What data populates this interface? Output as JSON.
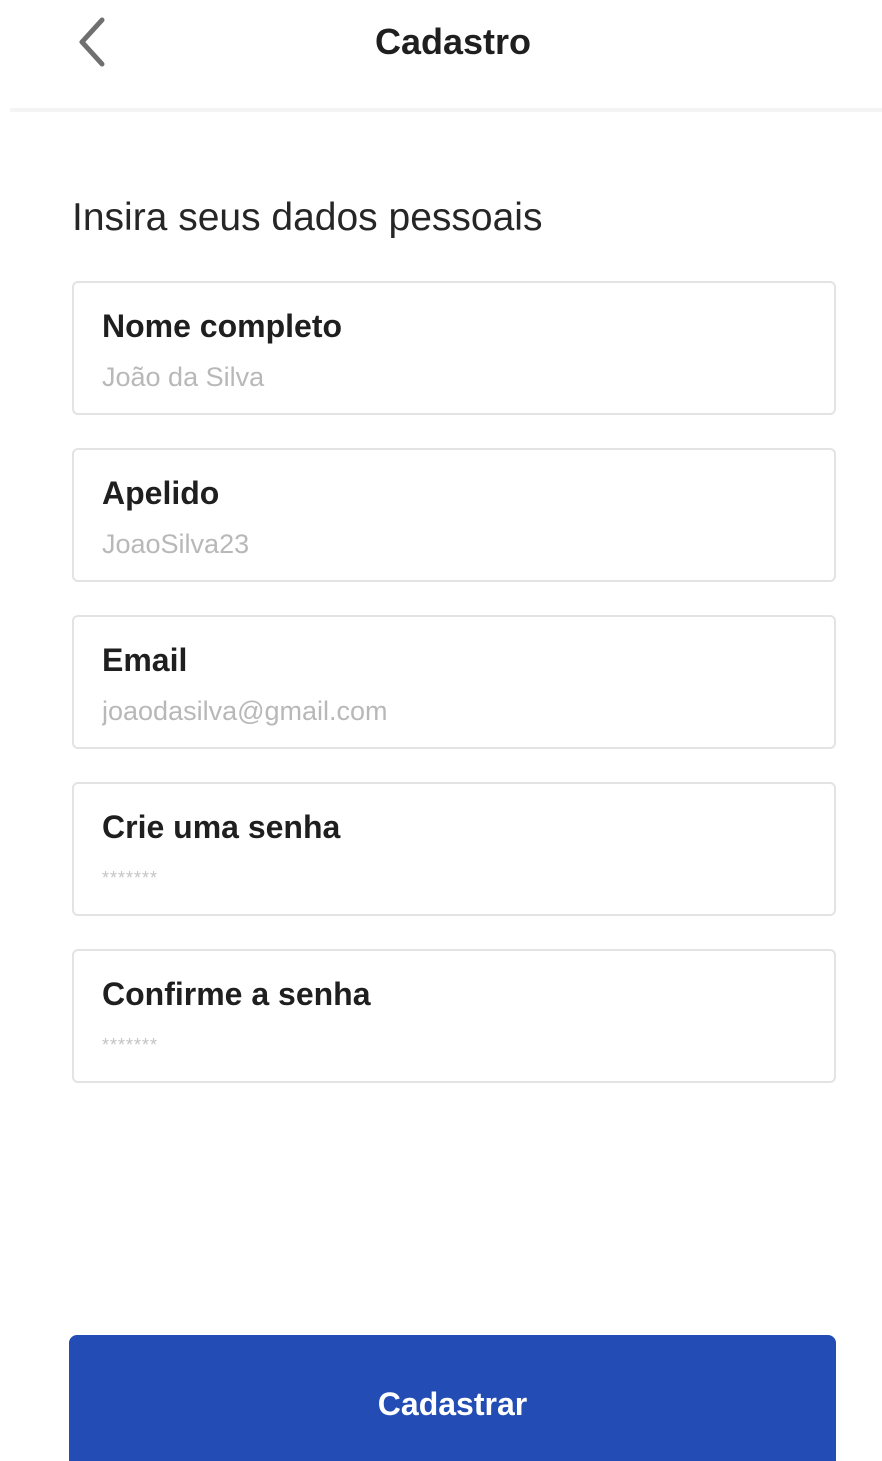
{
  "header": {
    "title": "Cadastro",
    "back_icon": "chevron-left-icon"
  },
  "form": {
    "heading": "Insira seus dados pessoais",
    "fields": [
      {
        "label": "Nome completo",
        "placeholder": "João da Silva",
        "value": ""
      },
      {
        "label": "Apelido",
        "placeholder": "JoaoSilva23",
        "value": ""
      },
      {
        "label": "Email",
        "placeholder": "joaodasilva@gmail.com",
        "value": ""
      },
      {
        "label": "Crie uma senha",
        "placeholder": "*******",
        "value": ""
      },
      {
        "label": "Confirme a senha",
        "placeholder": "*******",
        "value": ""
      }
    ]
  },
  "actions": {
    "submit_label": "Cadastrar"
  },
  "colors": {
    "primary": "#234db5",
    "field_border": "#e3e3e3",
    "placeholder": "#b8b8b8",
    "text": "#1f1f1f"
  }
}
